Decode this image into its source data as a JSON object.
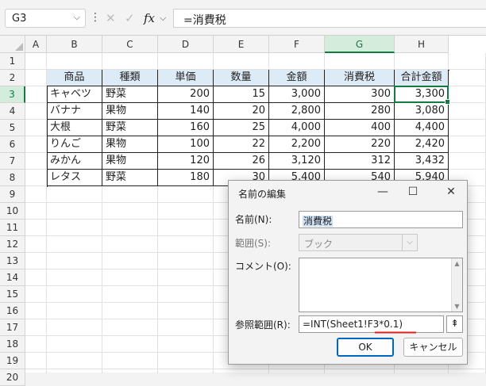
{
  "formula_bar": {
    "name_box": "G3",
    "name_box_dropdown": "⌵",
    "more_icon": "⋮",
    "cancel_icon": "✕",
    "enter_icon": "✓",
    "fx_label": "fx",
    "fx_dropdown": "⌵",
    "formula": "=消費税"
  },
  "columns": [
    "A",
    "B",
    "C",
    "D",
    "E",
    "F",
    "G",
    "H"
  ],
  "rows": [
    "1",
    "2",
    "3",
    "4",
    "5",
    "6",
    "7",
    "8",
    "9",
    "10",
    "11",
    "12",
    "13",
    "14",
    "15",
    "16",
    "17",
    "18",
    "19",
    "20"
  ],
  "table": {
    "headers": [
      "商品",
      "種類",
      "単価",
      "数量",
      "金額",
      "消費税",
      "合計金額"
    ],
    "rows": [
      [
        "キャベツ",
        "野菜",
        "200",
        "15",
        "3,000",
        "300",
        "3,300"
      ],
      [
        "バナナ",
        "果物",
        "140",
        "20",
        "2,800",
        "280",
        "3,080"
      ],
      [
        "大根",
        "野菜",
        "160",
        "25",
        "4,000",
        "400",
        "4,400"
      ],
      [
        "りんご",
        "果物",
        "100",
        "22",
        "2,200",
        "220",
        "2,420"
      ],
      [
        "みかん",
        "果物",
        "120",
        "26",
        "3,120",
        "312",
        "3,432"
      ],
      [
        "レタス",
        "野菜",
        "180",
        "30",
        "5,400",
        "540",
        "5,940"
      ]
    ]
  },
  "dialog": {
    "title": "名前の編集",
    "minimize_icon": "—",
    "maximize_icon": "☐",
    "close_icon": "✕",
    "name_label": "名前(N):",
    "name_value": "消費税",
    "scope_label": "範囲(S):",
    "scope_value": "ブック",
    "scope_dropdown": "⌵",
    "comment_label": "コメント(O):",
    "comment_value": "",
    "scroll_up": "▲",
    "scroll_down": "▼",
    "refers_label": "参照範囲(R):",
    "refers_value": "=INT(Sheet1!F3*0.1)",
    "collapse_icon": "⇞",
    "ok_label": "OK",
    "cancel_label": "キャンセル"
  },
  "colors": {
    "header_fill": "#ddebf7",
    "selection": "#107c41",
    "annotation_underline": "#e01e1e",
    "ok_border": "#0067c0"
  }
}
